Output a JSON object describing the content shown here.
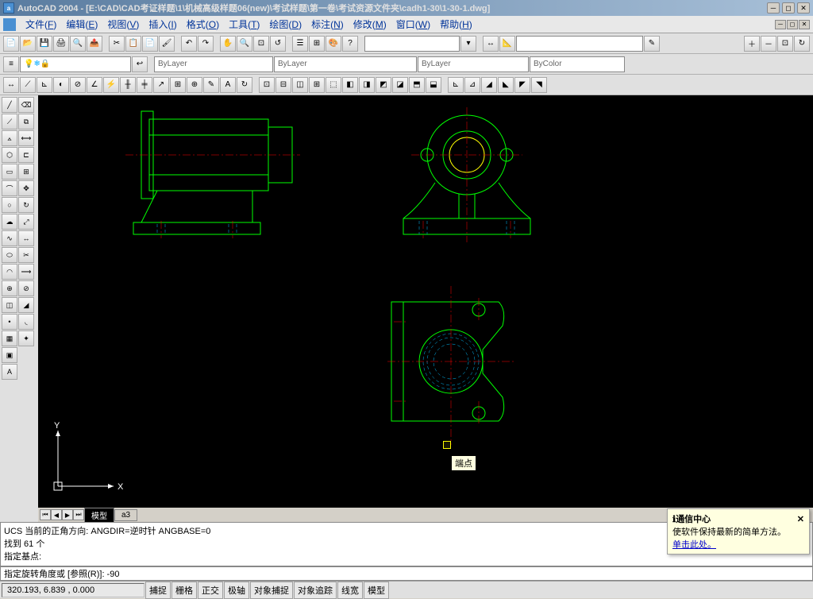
{
  "app": {
    "title": "AutoCAD 2004 - [E:\\CAD\\CAD考证样题\\1\\机械高级样题06(new)\\考试样题\\第一卷\\考试资源文件夹\\cadh1-30\\1-30-1.dwg]"
  },
  "menu": {
    "items": [
      {
        "label": "文件",
        "key": "F"
      },
      {
        "label": "编辑",
        "key": "E"
      },
      {
        "label": "视图",
        "key": "V"
      },
      {
        "label": "插入",
        "key": "I"
      },
      {
        "label": "格式",
        "key": "O"
      },
      {
        "label": "工具",
        "key": "T"
      },
      {
        "label": "绘图",
        "key": "D"
      },
      {
        "label": "标注",
        "key": "N"
      },
      {
        "label": "修改",
        "key": "M"
      },
      {
        "label": "窗口",
        "key": "W"
      },
      {
        "label": "帮助",
        "key": "H"
      }
    ]
  },
  "layers": {
    "bylayer": "ByLayer",
    "bycolor": "ByColor"
  },
  "tabs": {
    "model": "模型",
    "a3": "a3"
  },
  "ucs": {
    "x": "X",
    "y": "Y"
  },
  "tooltip": {
    "endpoint": "端点"
  },
  "command": {
    "line1": "UCS 当前的正角方向:  ANGDIR=逆时针  ANGBASE=0",
    "line2": "找到 61 个",
    "line3": "指定基点:",
    "prompt": "指定旋转角度或 [参照(R)]: -90"
  },
  "status": {
    "coords": "320.193, 6.839 , 0.000",
    "buttons": [
      "捕捉",
      "栅格",
      "正交",
      "极轴",
      "对象捕捉",
      "对象追踪",
      "线宽",
      "模型"
    ]
  },
  "notification": {
    "title": "通信中心",
    "body": "使软件保持最新的简单方法。",
    "link": "单击此处。"
  }
}
